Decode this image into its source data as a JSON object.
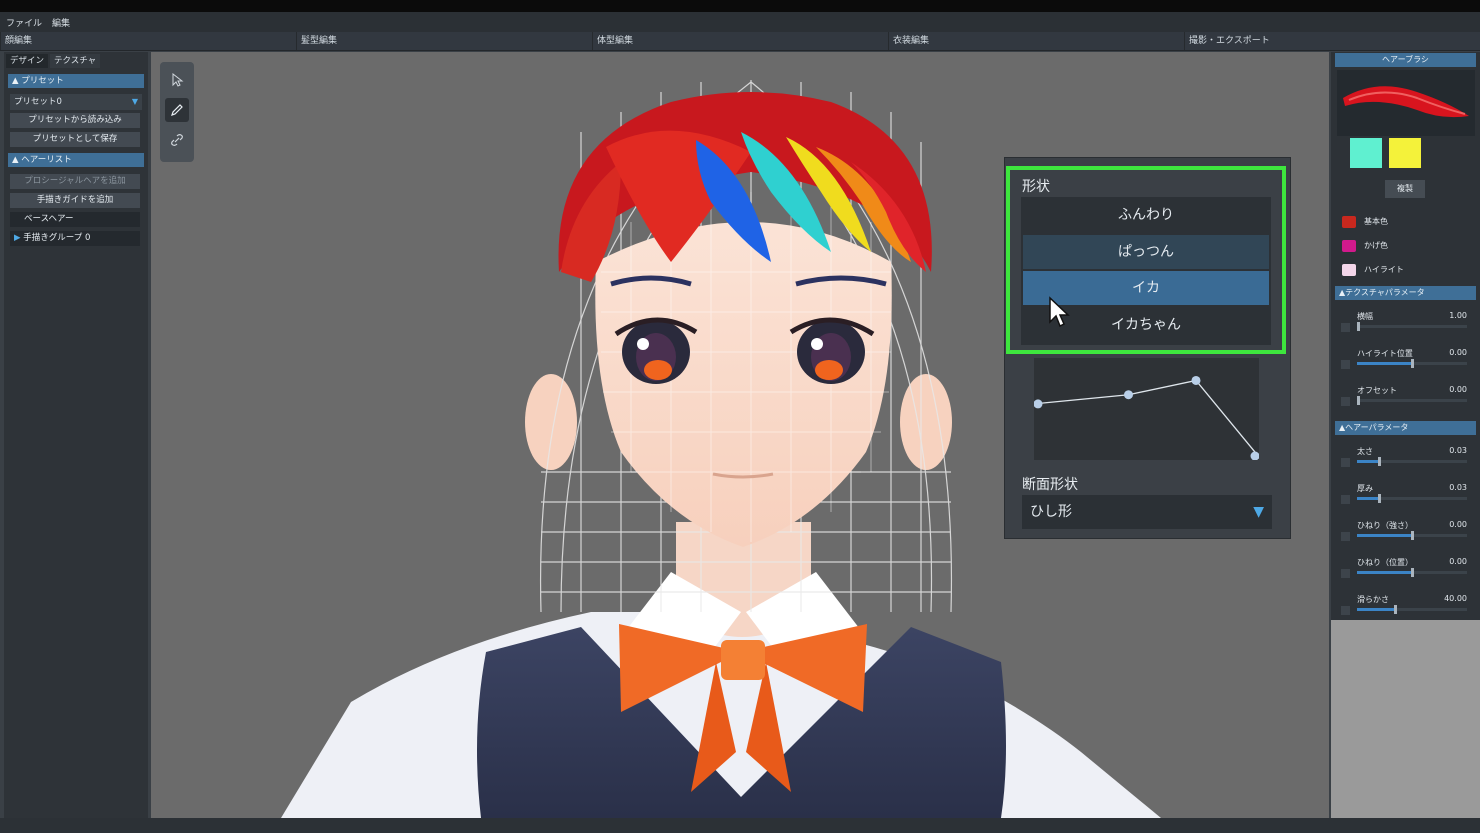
{
  "menu": {
    "items": [
      "ファイル",
      "編集"
    ]
  },
  "modes": [
    "顔編集",
    "髪型編集",
    "体型編集",
    "衣装編集",
    "撮影・エクスポート"
  ],
  "left_panel": {
    "tabs": [
      "デザイン",
      "テクスチャ"
    ],
    "preset_section": "プリセット",
    "preset_selected": "プリセット0",
    "load_preset": "プリセットから読み込み",
    "save_preset": "プリセットとして保存",
    "hairlist_section": "ヘアーリスト",
    "add_procedural": "プロシージャルヘアを追加",
    "add_guide": "手描きガイドを追加",
    "base_hair": "ベースヘアー",
    "group": "手描きグループ 0"
  },
  "shape_panel": {
    "title": "形状",
    "options": [
      "ふんわり",
      "ぱっつん",
      "イカ",
      "イカちゃん"
    ],
    "selected": "イカ",
    "cross_section_label": "断面形状",
    "cross_section_value": "ひし形",
    "curve_points": [
      [
        0.0,
        0.55
      ],
      [
        0.42,
        0.64
      ],
      [
        0.72,
        0.78
      ],
      [
        1.0,
        0.03
      ]
    ]
  },
  "right_panel": {
    "brush_title": "ヘアーブラシ",
    "duplicate": "複製",
    "swatch_colors": [
      "#5ff0d0",
      "#f4f23a"
    ],
    "colors": [
      {
        "label": "基本色",
        "color": "#c8281e"
      },
      {
        "label": "かげ色",
        "color": "#d21a8c"
      },
      {
        "label": "ハイライト",
        "color": "#f4d6ea"
      }
    ],
    "texture_section": "テクスチャパラメータ",
    "texture_params": [
      {
        "label": "横幅",
        "value": "1.00",
        "level": 0.0
      },
      {
        "label": "ハイライト位置",
        "value": "0.00",
        "level": 0.5
      },
      {
        "label": "オフセット",
        "value": "0.00",
        "level": 0.0
      }
    ],
    "hair_section": "ヘアーパラメータ",
    "hair_params": [
      {
        "label": "太さ",
        "value": "0.03",
        "level": 0.2
      },
      {
        "label": "厚み",
        "value": "0.03",
        "level": 0.2
      },
      {
        "label": "ひねり（強さ）",
        "value": "0.00",
        "level": 0.5
      },
      {
        "label": "ひねり（位置）",
        "value": "0.00",
        "level": 0.5
      },
      {
        "label": "滑らかさ",
        "value": "40.00",
        "level": 0.35
      }
    ]
  }
}
